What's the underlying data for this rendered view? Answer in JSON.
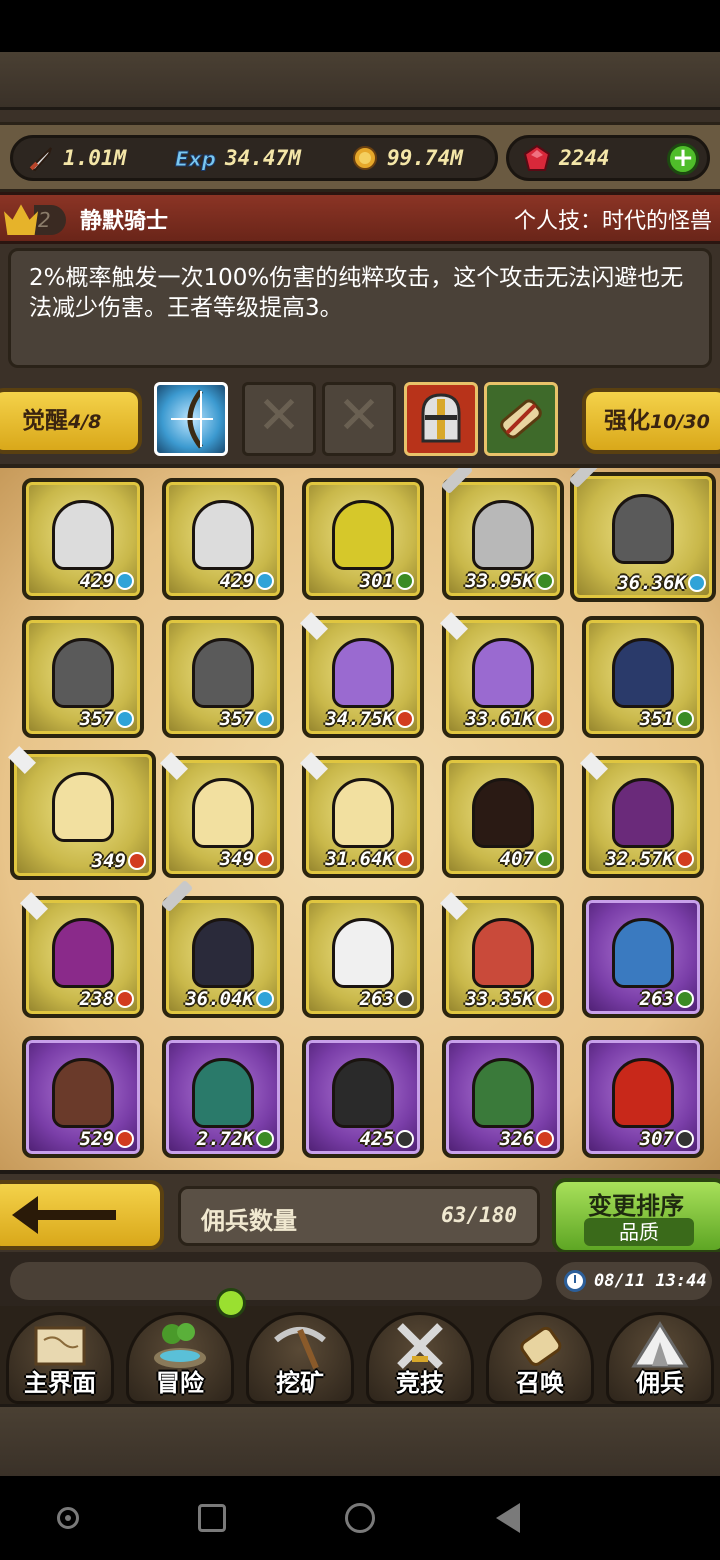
{
  "resources": {
    "attack": {
      "icon": "sword-icon",
      "value": "1.01M"
    },
    "exp": {
      "icon": "exp-icon",
      "value": "34.47M"
    },
    "gold": {
      "icon": "gold-coin-icon",
      "value": "99.74M"
    },
    "gems": {
      "icon": "red-gem-icon",
      "value": "2244"
    }
  },
  "hero": {
    "rank": "2",
    "name": "静默骑士",
    "skill_label": "个人技：时代的怪兽",
    "description": "2%概率触发一次100%伤害的纯粹攻击，这个攻击无法闪避也无法减少伤害。王者等级提高3。"
  },
  "skills_row": {
    "awaken_label": "觉醒",
    "awaken_value": "4/8",
    "enhance_label": "强化",
    "enhance_value": "10/30"
  },
  "mercenaries": [
    {
      "level": "429",
      "rarity": "gold",
      "badge": "star",
      "color": "#dcdcdc"
    },
    {
      "level": "429",
      "rarity": "gold",
      "badge": "star",
      "color": "#dcdcdc"
    },
    {
      "level": "301",
      "rarity": "gold",
      "badge": "plus",
      "color": "#d6c82a"
    },
    {
      "level": "33.95K",
      "rarity": "gold",
      "badge": "plus",
      "color": "#b8b8b8",
      "tag": "sword"
    },
    {
      "level": "36.36K",
      "rarity": "gold",
      "badge": "star",
      "color": "#5a5a5a",
      "tag": "sword",
      "selected": true
    },
    {
      "level": "357",
      "rarity": "gold",
      "badge": "star",
      "color": "#5a5a5a"
    },
    {
      "level": "357",
      "rarity": "gold",
      "badge": "star",
      "color": "#5a5a5a"
    },
    {
      "level": "34.75K",
      "rarity": "gold",
      "badge": "up",
      "color": "#9a6ad0",
      "tag": "flag"
    },
    {
      "level": "33.61K",
      "rarity": "gold",
      "badge": "up",
      "color": "#9a6ad0",
      "tag": "flag"
    },
    {
      "level": "351",
      "rarity": "gold",
      "badge": "plus",
      "color": "#2a3a6a"
    },
    {
      "level": "349",
      "rarity": "gold",
      "badge": "up",
      "color": "#f2e0a0",
      "tag": "flag",
      "selected": true
    },
    {
      "level": "349",
      "rarity": "gold",
      "badge": "up",
      "color": "#f2e0a0",
      "tag": "flag"
    },
    {
      "level": "31.64K",
      "rarity": "gold",
      "badge": "up",
      "color": "#f2e0a0",
      "tag": "flag"
    },
    {
      "level": "407",
      "rarity": "gold",
      "badge": "plus",
      "color": "#2a1a14"
    },
    {
      "level": "32.57K",
      "rarity": "gold",
      "badge": "up",
      "color": "#6a2a7a",
      "tag": "flag"
    },
    {
      "level": "238",
      "rarity": "gold",
      "badge": "up",
      "color": "#8a2a8a",
      "tag": "flag"
    },
    {
      "level": "36.04K",
      "rarity": "gold",
      "badge": "star",
      "color": "#2a2a3a",
      "tag": "sword"
    },
    {
      "level": "263",
      "rarity": "gold",
      "badge": "q",
      "color": "#f0f0f0"
    },
    {
      "level": "33.35K",
      "rarity": "gold",
      "badge": "up",
      "color": "#c94a3a",
      "tag": "flag"
    },
    {
      "level": "263",
      "rarity": "purple",
      "badge": "plus",
      "color": "#3a7ac0"
    },
    {
      "level": "529",
      "rarity": "purple",
      "badge": "up",
      "color": "#6a3a2a"
    },
    {
      "level": "2.72K",
      "rarity": "purple",
      "badge": "plus",
      "color": "#2a7a6a"
    },
    {
      "level": "425",
      "rarity": "purple",
      "badge": "q",
      "color": "#2a2a2a"
    },
    {
      "level": "326",
      "rarity": "purple",
      "badge": "up",
      "color": "#3a7a3a"
    },
    {
      "level": "307",
      "rarity": "purple",
      "badge": "q",
      "color": "#c8281a"
    }
  ],
  "bottom_bar": {
    "count_label": "佣兵数量",
    "count_value": "63/180",
    "sort_title": "变更排序",
    "sort_sub": "品质"
  },
  "status": {
    "time": "08/11 13:44"
  },
  "nav": [
    {
      "label": "主界面",
      "icon": "map-scroll-icon"
    },
    {
      "label": "冒险",
      "icon": "island-icon",
      "notify": true
    },
    {
      "label": "挖矿",
      "icon": "pickaxe-icon"
    },
    {
      "label": "竞技",
      "icon": "crossed-swords-icon"
    },
    {
      "label": "召唤",
      "icon": "summon-scroll-icon"
    },
    {
      "label": "佣兵",
      "icon": "tent-icon"
    }
  ]
}
